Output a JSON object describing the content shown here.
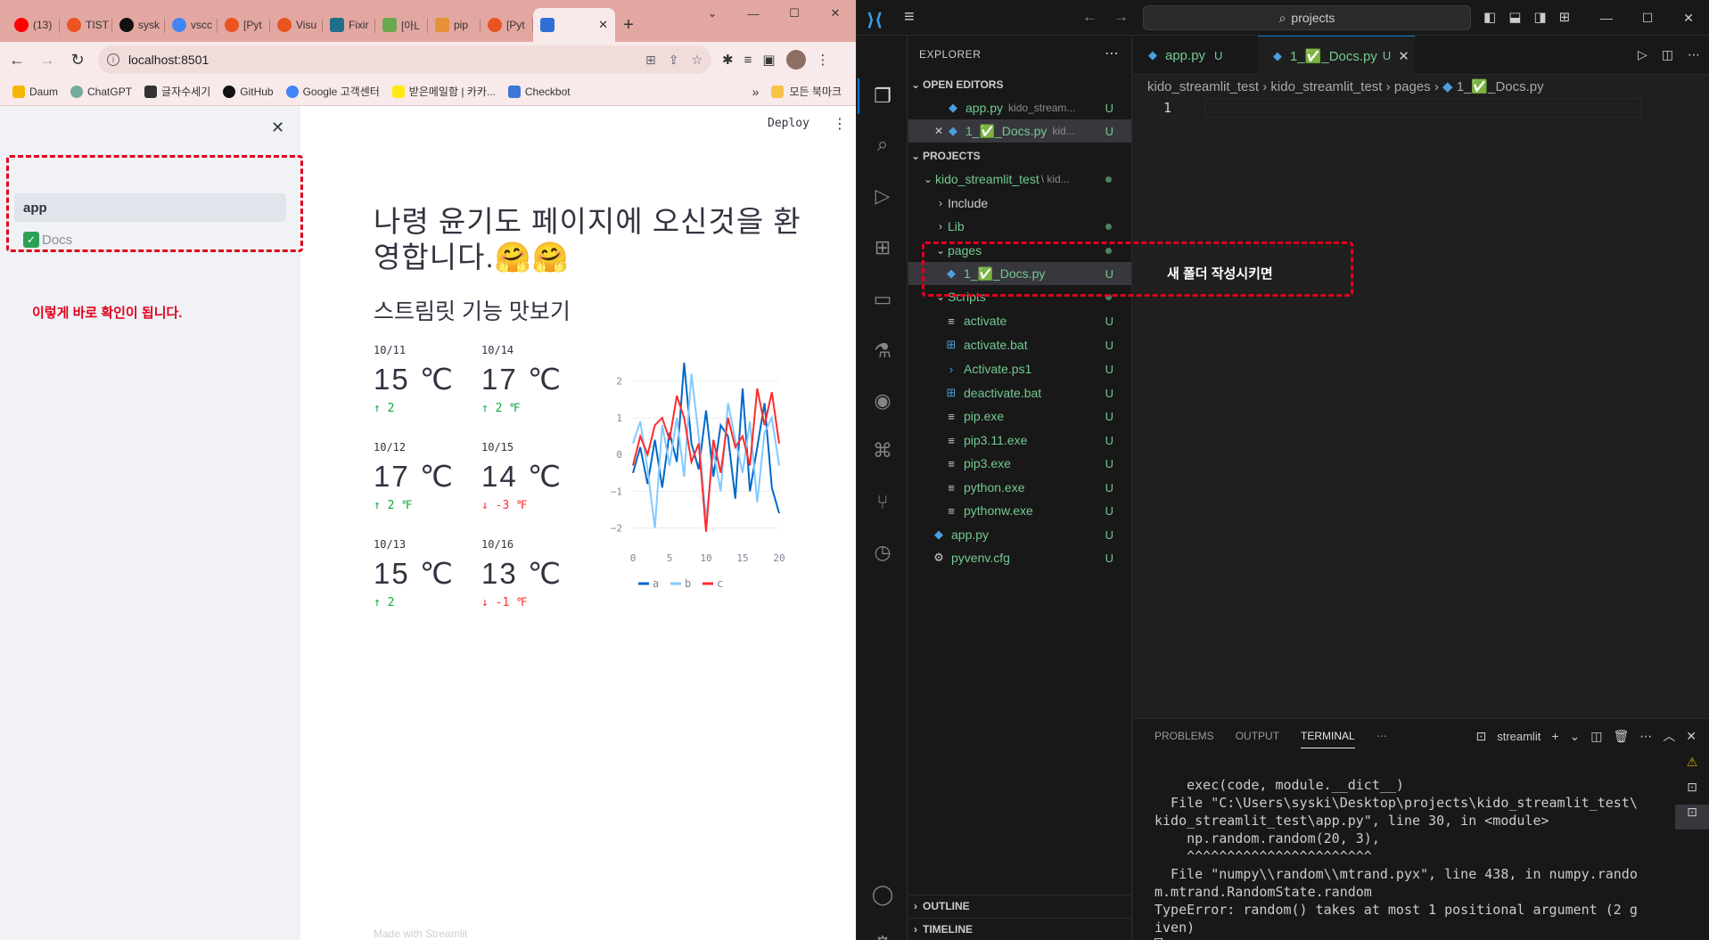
{
  "browser": {
    "tabs": [
      {
        "label": "(13)",
        "icon": "youtube-icon",
        "color": "#ff0000"
      },
      {
        "label": "TIST",
        "icon": "tistory-icon",
        "color": "#eb531f"
      },
      {
        "label": "sysk",
        "icon": "github-icon",
        "color": "#111111"
      },
      {
        "label": "vscc",
        "icon": "google-icon",
        "color": "#4285f4"
      },
      {
        "label": "[Pyt",
        "icon": "tistory-icon",
        "color": "#eb531f"
      },
      {
        "label": "Visu",
        "icon": "tistory-icon",
        "color": "#eb531f"
      },
      {
        "label": "Fixir",
        "icon": "fix-icon",
        "color": "#1f6f8b"
      },
      {
        "label": "[아L",
        "icon": "tree-icon",
        "color": "#6aa84f"
      },
      {
        "label": "pip",
        "icon": "pip-icon",
        "color": "#e69138"
      },
      {
        "label": "[Pyt",
        "icon": "tistory-icon",
        "color": "#eb531f"
      }
    ],
    "active_tab_close": "✕",
    "new_tab": "+",
    "url": "localhost:8501",
    "bookmarks": [
      {
        "label": "Daum",
        "color": "#f4b400"
      },
      {
        "label": "ChatGPT",
        "color": "#74aa9c"
      },
      {
        "label": "글자수세기",
        "color": "#333333"
      },
      {
        "label": "GitHub",
        "color": "#111111"
      },
      {
        "label": "Google 고객센터",
        "color": "#4285f4"
      },
      {
        "label": "받은메일함 | 카카...",
        "color": "#ffe812"
      },
      {
        "label": "Checkbot",
        "color": "#3c78d8"
      }
    ],
    "bookmarks_more": "»",
    "bookmarks_folder": "모든 북마크"
  },
  "streamlit": {
    "sidebar_items": [
      "app",
      "Docs"
    ],
    "sidebar_note": "이렇게 바로 확인이 됩니다.",
    "deploy": "Deploy",
    "title": "나령 윤기도 페이지에 오신것을 환영합니다.🤗🤗",
    "subheader": "스트림릿 기능 맛보기",
    "metrics": [
      {
        "date": "10/11",
        "value": "15 ℃",
        "delta": "↑ 2"
      },
      {
        "date": "10/14",
        "value": "17 ℃",
        "delta": "↑ 2 ℉"
      },
      {
        "date": "10/12",
        "value": "17 ℃",
        "delta": "↑ 2 ℉"
      },
      {
        "date": "10/15",
        "value": "14 ℃",
        "delta": "↓ -3 ℉"
      },
      {
        "date": "10/13",
        "value": "15 ℃",
        "delta": "↑ 2"
      },
      {
        "date": "10/16",
        "value": "13 ℃",
        "delta": "↓ -1 ℉"
      }
    ],
    "footer": "Made with Streamlit"
  },
  "chart_data": {
    "type": "line",
    "x": [
      0,
      1,
      2,
      3,
      4,
      5,
      6,
      7,
      8,
      9,
      10,
      11,
      12,
      13,
      14,
      15,
      16,
      17,
      18,
      19,
      20
    ],
    "series": [
      {
        "name": "a",
        "color": "#0068c9",
        "values": [
          -0.5,
          0.2,
          -0.8,
          0.4,
          -0.9,
          0.6,
          -0.2,
          2.5,
          0.3,
          -0.4,
          1.2,
          -0.6,
          0.8,
          0.5,
          -1.2,
          1.8,
          -1.0,
          0.2,
          1.4,
          -0.9,
          -1.6
        ]
      },
      {
        "name": "b",
        "color": "#83c9ff",
        "values": [
          0.3,
          0.9,
          -0.4,
          -2.0,
          0.8,
          -0.3,
          1.0,
          -0.6,
          2.2,
          0.5,
          -1.8,
          0.1,
          -1.0,
          1.4,
          0.4,
          -0.5,
          0.9,
          -1.3,
          0.6,
          1.0,
          -0.3
        ]
      },
      {
        "name": "c",
        "color": "#ff2b2b",
        "values": [
          -0.3,
          0.5,
          0.0,
          0.8,
          1.0,
          0.4,
          1.6,
          1.0,
          -0.2,
          0.3,
          -2.1,
          0.4,
          -0.5,
          1.0,
          0.2,
          0.5,
          -0.3,
          1.8,
          0.8,
          1.7,
          0.3
        ]
      }
    ],
    "xticks": [
      "0",
      "5",
      "10",
      "15",
      "20"
    ],
    "yticks": [
      "2",
      "1",
      "0",
      "−1",
      "−2"
    ],
    "ylim": [
      -2.3,
      2.6
    ],
    "xlim": [
      0,
      20
    ],
    "legend": "bottom"
  },
  "vscode": {
    "search": "projects",
    "explorer_title": "EXPLORER",
    "open_editors_label": "OPEN EDITORS",
    "open_editors": [
      {
        "name": "app.py",
        "path": "kido_stream...",
        "badge": "U"
      },
      {
        "name": "1_✅_Docs.py",
        "path": "kid...",
        "badge": "U"
      }
    ],
    "projects_label": "PROJECTS",
    "root_folder": "kido_streamlit_test",
    "root_path": "\\ kid...",
    "folders": [
      "Include",
      "Lib",
      "pages"
    ],
    "pages_file": "1_✅_Docs.py",
    "scripts_folder": "Scripts",
    "script_files": [
      "activate",
      "activate.bat",
      "Activate.ps1",
      "deactivate.bat",
      "pip.exe",
      "pip3.11.exe",
      "pip3.exe",
      "python.exe",
      "pythonw.exe"
    ],
    "root_files": [
      "app.py",
      "pyvenv.cfg"
    ],
    "badge": "U",
    "editor_tabs": [
      "app.py",
      "1_✅_Docs.py"
    ],
    "breadcrumb": [
      "kido_streamlit_test",
      "kido_streamlit_test",
      "pages",
      "1_✅_Docs.py"
    ],
    "line_number": "1",
    "editor_note": "새 폴더 작성시키면",
    "panel_tabs": [
      "PROBLEMS",
      "OUTPUT",
      "TERMINAL"
    ],
    "terminal_name": "streamlit",
    "terminal_lines": [
      "    exec(code, module.__dict__)",
      "  File \"C:\\Users\\syski\\Desktop\\projects\\kido_streamlit_test\\",
      "kido_streamlit_test\\app.py\", line 30, in <module>",
      "    np.random.random(20, 3),",
      "    ^^^^^^^^^^^^^^^^^^^^^^^",
      "  File \"numpy\\\\random\\\\mtrand.pyx\", line 438, in numpy.rando",
      "m.mtrand.RandomState.random",
      "TypeError: random() takes at most 1 positional argument (2 g",
      "iven)"
    ],
    "outline": "OUTLINE",
    "timeline": "TIMELINE"
  }
}
